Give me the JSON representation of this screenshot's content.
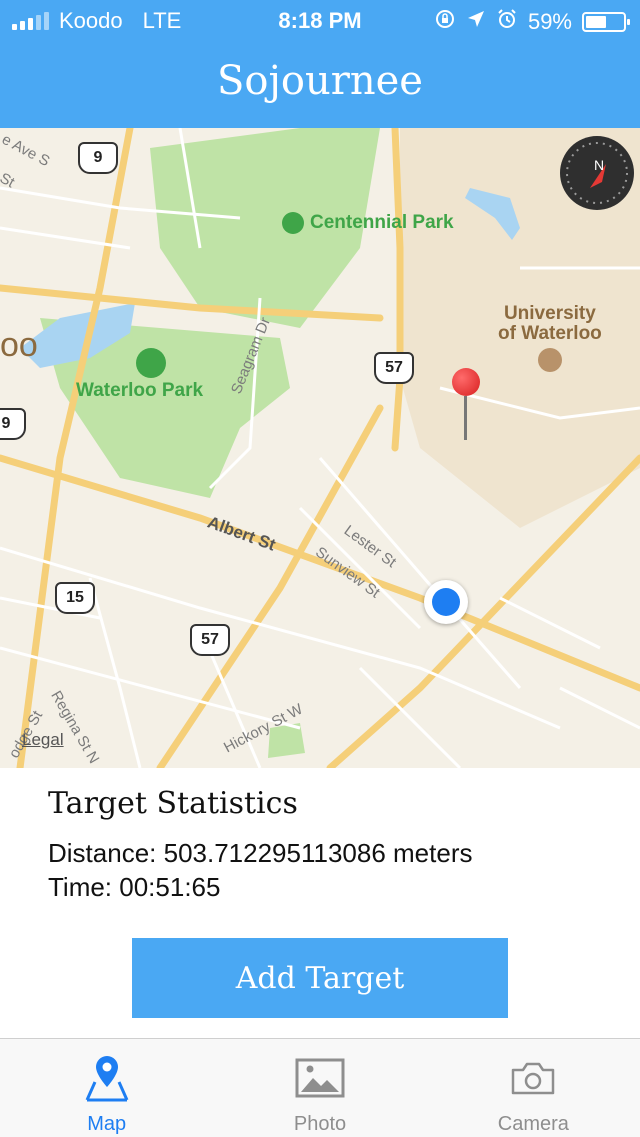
{
  "status_bar": {
    "carrier": "Koodo",
    "network": "LTE",
    "time": "8:18 PM",
    "battery_percent": "59%",
    "battery_level": 0.59
  },
  "header": {
    "title": "Sojournee"
  },
  "map": {
    "labels": {
      "centennial_park": "Centennial Park",
      "waterloo_park": "Waterloo Park",
      "university_line1": "University",
      "university_line2": "of Waterloo",
      "partial_oo": "oo",
      "seagram_dr": "Seagram Dr",
      "albert_st": "Albert St",
      "lester_st": "Lester St",
      "sunview_st": "Sunview St",
      "regina_st": "Regina St N",
      "dodge_st": "odge St",
      "hickory_st": "Hickory St W",
      "ave_s": "e Ave S",
      "st": "St"
    },
    "shields": {
      "r9_top": "9",
      "r9_left": "9",
      "r57_top": "57",
      "r15": "15",
      "r57_bottom": "57"
    },
    "compass_letter": "N",
    "legal": "Legal"
  },
  "stats": {
    "title": "Target Statistics",
    "distance": "Distance: 503.712295113086 meters",
    "time": "Time: 00:51:65"
  },
  "actions": {
    "add_target": "Add Target"
  },
  "tabs": [
    {
      "label": "Map",
      "active": true
    },
    {
      "label": "Photo",
      "active": false
    },
    {
      "label": "Camera",
      "active": false
    }
  ],
  "colors": {
    "primary": "#4aa8f3",
    "active_tab": "#1e7ef2",
    "park": "#bfe3a6",
    "water": "#a9d4f2"
  }
}
